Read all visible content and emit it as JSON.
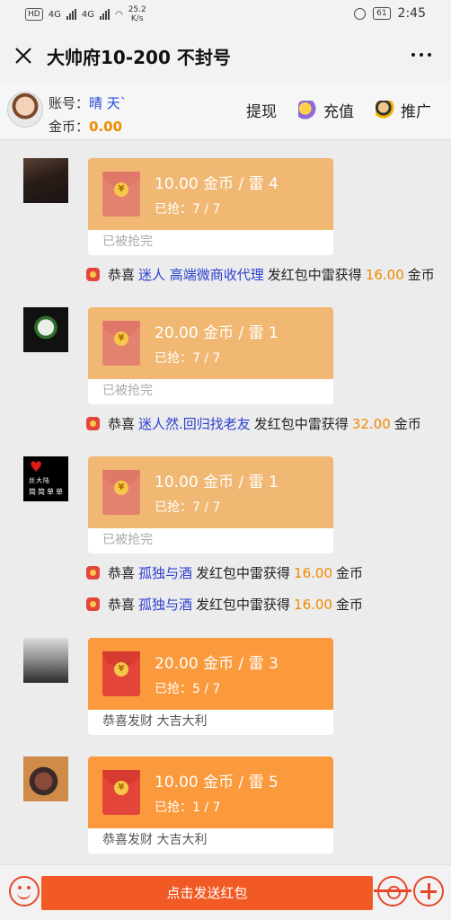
{
  "status_bar": {
    "hd_label": "HD",
    "net1": "4G",
    "net2": "4G",
    "speed_value": "25.2",
    "speed_unit": "K/s",
    "battery": "61",
    "time": "2:45"
  },
  "title_bar": {
    "title": "大帅府10-200 不封号"
  },
  "account": {
    "account_label": "账号：",
    "account_value": "晴 天`",
    "coins_label": "金币：",
    "coins_value": "0.00",
    "withdraw_label": "提现",
    "recharge_label": "充值",
    "promote_label": "推广"
  },
  "messages": [
    {
      "amount": "10.00 金币 / 雷 4",
      "grabbed": "已抢：7 / 7",
      "footer": "已被抢完",
      "state": "done"
    },
    {
      "amount": "20.00 金币 / 雷 1",
      "grabbed": "已抢：7 / 7",
      "footer": "已被抢完",
      "state": "done"
    },
    {
      "amount": "10.00 金币 / 雷 1",
      "grabbed": "已抢：7 / 7",
      "footer": "已被抢完",
      "state": "done",
      "avatar_text1": "丝大陆",
      "avatar_text2": "简简单单"
    },
    {
      "amount": "20.00 金币 / 雷 3",
      "grabbed": "已抢：5 / 7",
      "footer": "恭喜发财 大吉大利",
      "state": "live"
    },
    {
      "amount": "10.00 金币 / 雷 5",
      "grabbed": "已抢：1 / 7",
      "footer": "恭喜发财 大吉大利",
      "state": "live"
    }
  ],
  "coin_symbol": "¥",
  "notices": [
    {
      "prefix": "恭喜",
      "name": "迷人 高端微商收代理",
      "middle": "发红包中雷获得",
      "amount": "16.00",
      "suffix": "金币"
    },
    {
      "prefix": "恭喜",
      "name": "迷人然.回归找老友",
      "middle": "发红包中雷获得",
      "amount": "32.00",
      "suffix": "金币"
    },
    {
      "prefix": "恭喜",
      "name": "孤独与酒",
      "middle": "发红包中雷获得",
      "amount": "16.00",
      "suffix": "金币"
    },
    {
      "prefix": "恭喜",
      "name": "孤独与酒",
      "middle": "发红包中雷获得",
      "amount": "16.00",
      "suffix": "金币"
    }
  ],
  "bottom_bar": {
    "send_label": "点击发送红包"
  },
  "colors": {
    "accent": "#f15a24",
    "bubble_done": "#f0b873",
    "bubble_live": "#fa9a3c",
    "name_blue": "#2b3fd0",
    "amount_orange": "#f08a00"
  },
  "icons": [
    "close-icon",
    "more-icon",
    "recharge-icon",
    "promote-icon",
    "smile-icon",
    "gear-icon",
    "plus-icon",
    "coin-icon",
    "notice-icon"
  ]
}
